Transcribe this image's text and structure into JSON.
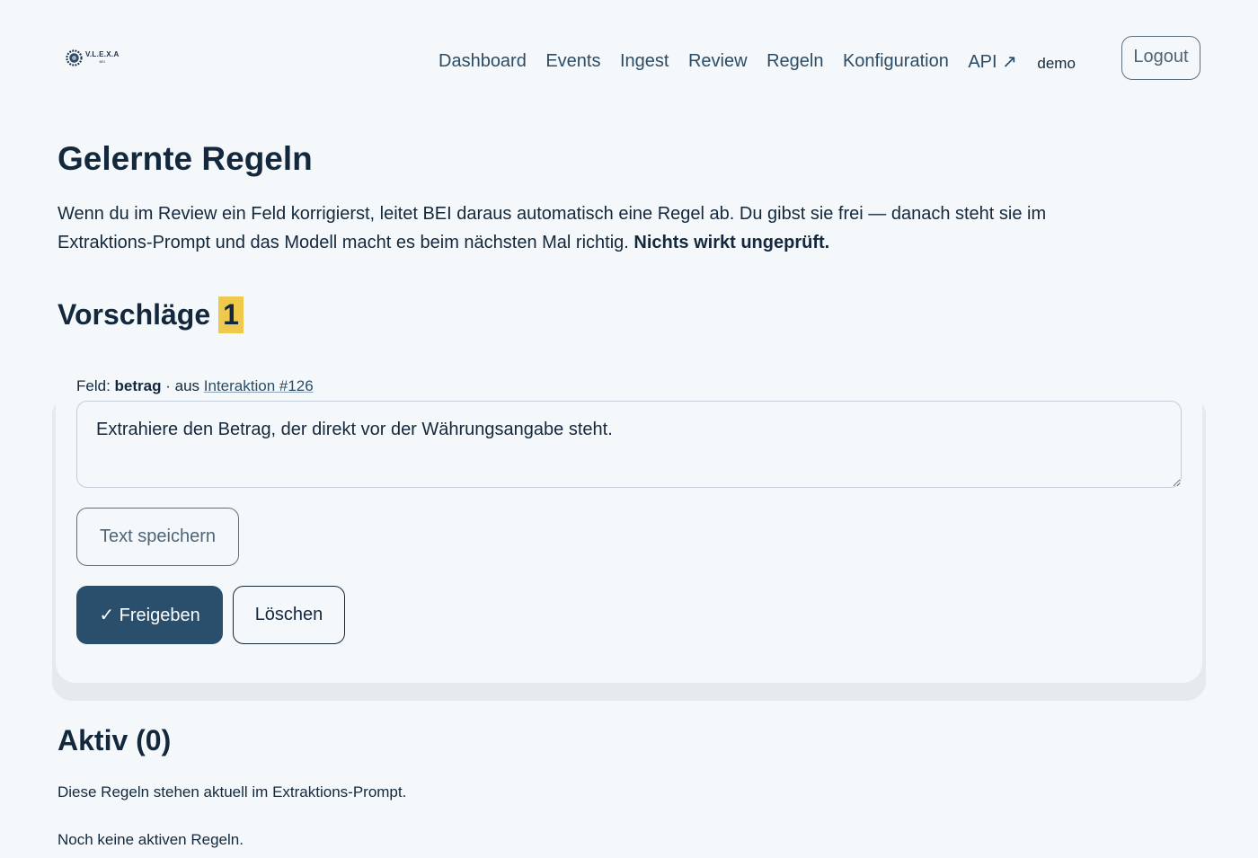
{
  "header": {
    "logo": {
      "name": "V.L.E.X.A",
      "tagline": "",
      "sub": "BEI"
    },
    "nav": [
      {
        "label": "Dashboard"
      },
      {
        "label": "Events"
      },
      {
        "label": "Ingest"
      },
      {
        "label": "Review"
      },
      {
        "label": "Regeln"
      },
      {
        "label": "Konfiguration"
      },
      {
        "label": "API ↗"
      }
    ],
    "user": "demo",
    "logout_label": "Logout"
  },
  "main": {
    "title": "Gelernte Regeln",
    "intro_text": "Wenn du im Review ein Feld korrigierst, leitet BEI daraus automatisch eine Regel ab. Du gibst sie frei — danach steht sie im Extraktions-Prompt und das Modell macht es beim nächsten Mal richtig.",
    "intro_bold": "Nichts wirkt ungeprüft.",
    "suggestions": {
      "title": "Vorschläge",
      "count": "1",
      "items": [
        {
          "field_prefix": "Feld:",
          "field_name": "betrag",
          "source_prefix": "· aus",
          "source_link": "Interaktion #126",
          "rule_text": "Extrahiere den Betrag, der direkt vor der Währungsangabe steht.",
          "save_label": "Text speichern",
          "approve_label": "✓ Freigeben",
          "delete_label": "Löschen"
        }
      ]
    },
    "active": {
      "title": "Aktiv (0)",
      "description": "Diese Regeln stehen aktuell im Extraktions-Prompt.",
      "empty_text": "Noch keine aktiven Regeln."
    }
  },
  "colors": {
    "background": "#f5f8fa",
    "text": "#13283d",
    "nav_link": "#2b4c66",
    "primary_button": "#2a4f6c",
    "badge": "#efc94c"
  }
}
